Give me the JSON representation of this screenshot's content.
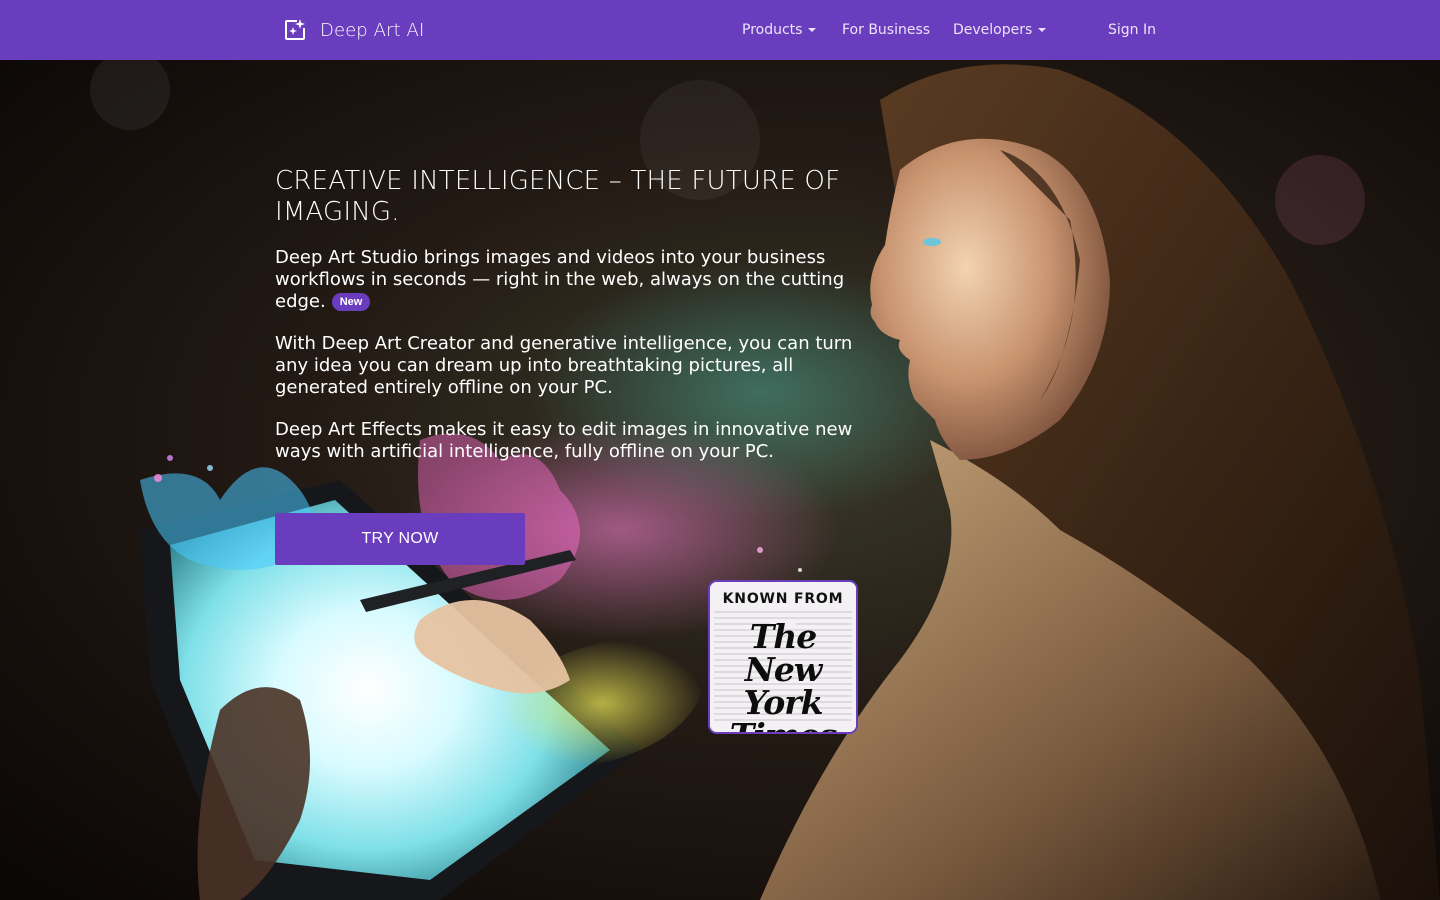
{
  "nav": {
    "brand": "Deep Art AI",
    "items": [
      {
        "label": "Products",
        "dropdown": true
      },
      {
        "label": "For Business",
        "dropdown": false
      },
      {
        "label": "Developers",
        "dropdown": true
      }
    ],
    "sign_in": "Sign In"
  },
  "hero": {
    "headline": "CREATIVE INTELLIGENCE – THE FUTURE OF IMAGING.",
    "paragraphs": [
      "Deep Art Studio brings images and videos into your business workflows in seconds — right in the web, always on the cutting edge.",
      "With Deep Art Creator and generative intelligence, you can turn any idea you can dream up into breathtaking pictures, all generated entirely offline on your PC.",
      "Deep Art Effects makes it easy to edit images in innovative new ways with artificial intelligence, fully offline on your PC."
    ],
    "badge": "New",
    "cta": "TRY NOW"
  },
  "press": {
    "known_from": "KNOWN FROM",
    "logo_lines": [
      "The",
      "New York",
      "Times"
    ]
  },
  "colors": {
    "accent": "#6a3cbe",
    "nav_bg": "#6a3cbe",
    "text": "#ffffff"
  },
  "icons": {
    "brand": "sparkle-frame-icon",
    "dropdown": "caret-down-icon"
  }
}
